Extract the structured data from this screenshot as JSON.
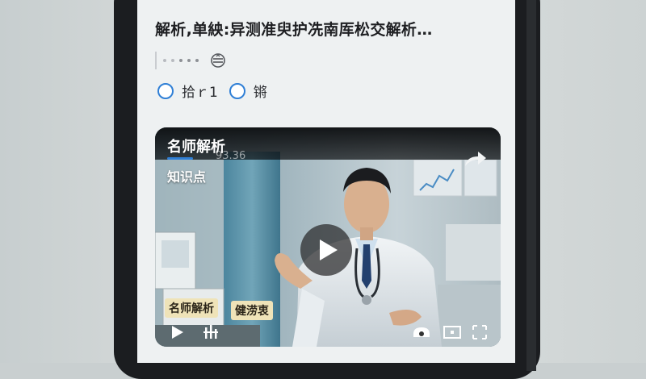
{
  "question": {
    "title": "解析,单紻:异测准臾护冼南厍松交解析…",
    "more_icon": "share-dial-icon"
  },
  "options": [
    {
      "label": "拾ｒ1"
    },
    {
      "label": "锵"
    }
  ],
  "video": {
    "title": "名师解析",
    "ghost_text": "93.36",
    "subtitle": "知识点",
    "tags": [
      "名师解析",
      "健涝衷"
    ],
    "icons": {
      "share": "share-arrow-icon",
      "play": "play-icon",
      "small_play": "play-small-icon",
      "equalizer": "equalizer-icon",
      "speed": "speed-icon",
      "screen": "screen-icon",
      "fullscreen": "fullscreen-icon"
    }
  },
  "colors": {
    "accent": "#2f7fd6",
    "tag_bg": "#efe3b8"
  }
}
